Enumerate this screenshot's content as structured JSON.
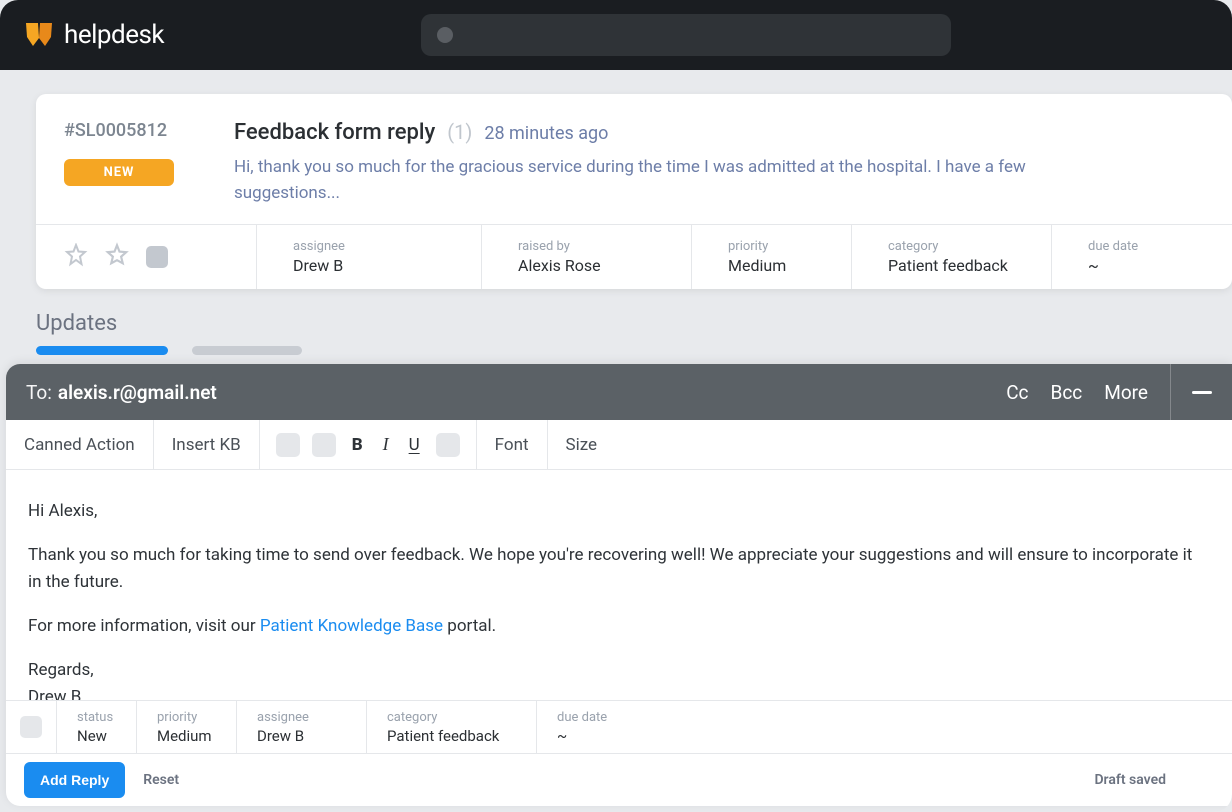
{
  "brand": "helpdesk",
  "ticket": {
    "id": "#SL0005812",
    "badge": "NEW",
    "title": "Feedback form reply",
    "count": "(1)",
    "time": "28 minutes ago",
    "preview": "Hi, thank you so much for the gracious service during the time I was admitted at the hospital. I have a few suggestions...",
    "meta": {
      "assignee_label": "assignee",
      "assignee_value": "Drew B",
      "raised_label": "raised by",
      "raised_value": "Alexis Rose",
      "priority_label": "priority",
      "priority_value": "Medium",
      "category_label": "category",
      "category_value": "Patient feedback",
      "due_label": "due date",
      "due_value": "~"
    }
  },
  "updates": {
    "title": "Updates"
  },
  "compose": {
    "to_label": "To:",
    "to_value": "alexis.r@gmail.net",
    "cc": "Cc",
    "bcc": "Bcc",
    "more": "More",
    "toolbar": {
      "canned": "Canned Action",
      "insert_kb": "Insert KB",
      "bold": "B",
      "italic": "I",
      "underline": "U",
      "font": "Font",
      "size": "Size"
    },
    "body": {
      "greeting": "Hi Alexis,",
      "p1": "Thank you so much for taking time to send over feedback. We hope you're recovering well! We appreciate your suggestions and will ensure to incorporate it in the future.",
      "p2_pre": "For more information, visit our ",
      "p2_link": "Patient Knowledge Base",
      "p2_post": " portal.",
      "signoff": "Regards,",
      "signature": "Drew B."
    },
    "reply_meta": {
      "status_label": "status",
      "status_value": "New",
      "priority_label": "priority",
      "priority_value": "Medium",
      "assignee_label": "assignee",
      "assignee_value": "Drew B",
      "category_label": "category",
      "category_value": "Patient feedback",
      "due_label": "due date",
      "due_value": "~"
    },
    "footer": {
      "add_reply": "Add Reply",
      "reset": "Reset",
      "draft_saved": "Draft saved"
    }
  }
}
